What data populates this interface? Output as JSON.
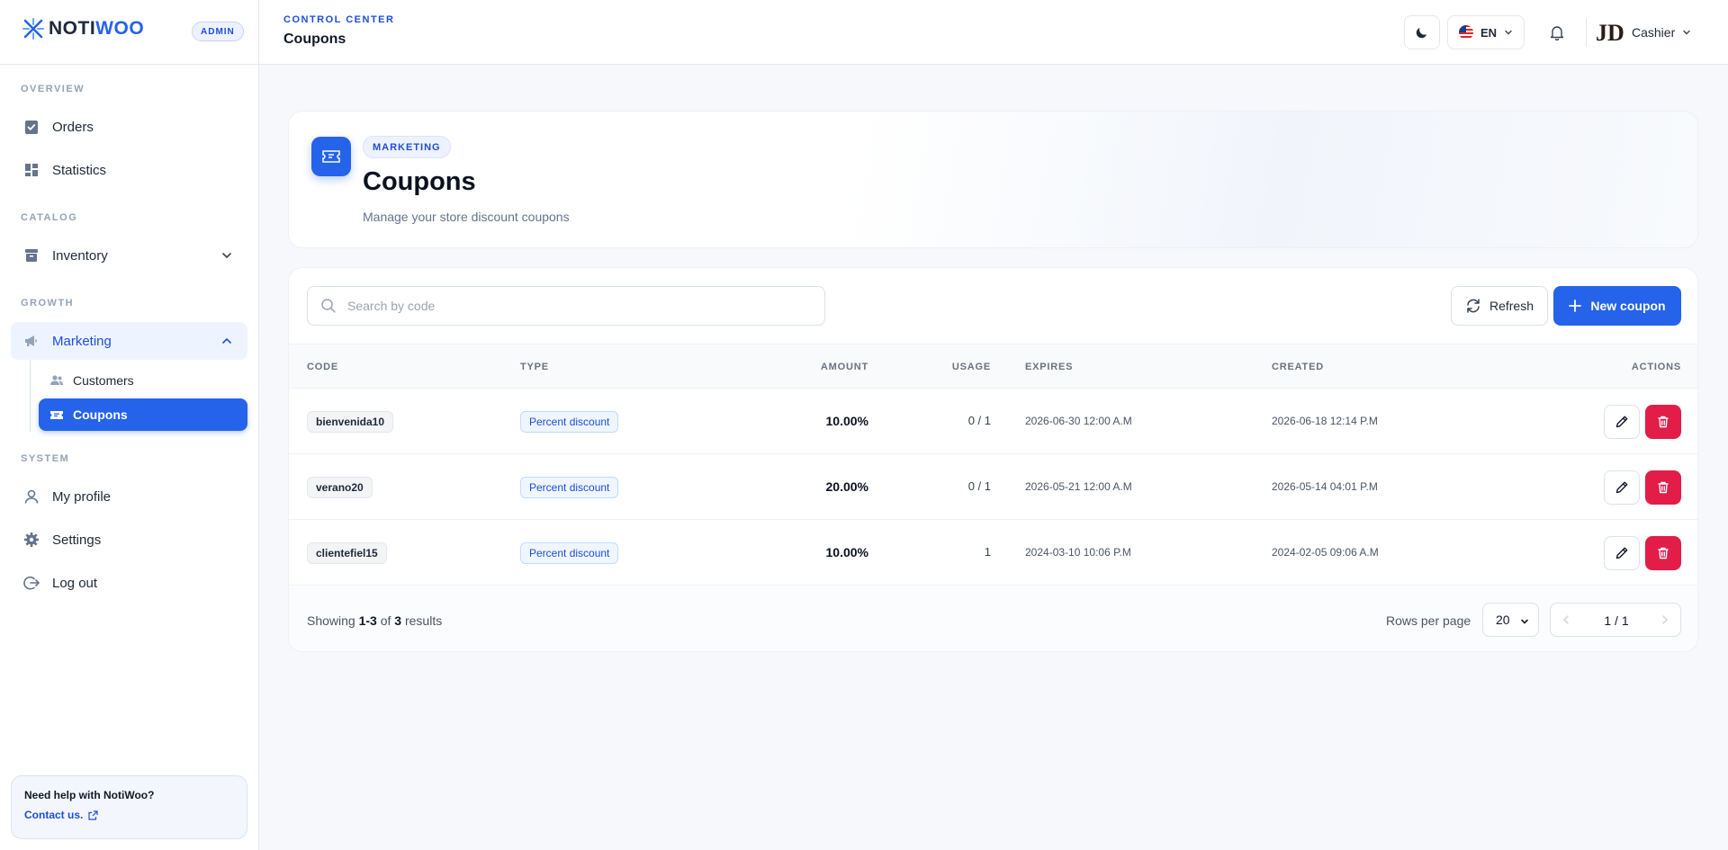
{
  "brand": {
    "name_part1": "NOTI",
    "name_part2": "WOO",
    "role_badge": "ADMIN"
  },
  "sidebar": {
    "sections": {
      "overview": "OVERVIEW",
      "catalog": "CATALOG",
      "growth": "GROWTH",
      "system": "SYSTEM"
    },
    "items": {
      "orders": "Orders",
      "statistics": "Statistics",
      "inventory": "Inventory",
      "marketing": "Marketing",
      "customers": "Customers",
      "coupons": "Coupons",
      "my_profile": "My profile",
      "settings": "Settings",
      "log_out": "Log out"
    },
    "help": {
      "title": "Need help with NotiWoo?",
      "link": "Contact us."
    }
  },
  "header": {
    "breadcrumb": "CONTROL CENTER",
    "title": "Coupons",
    "language": "EN",
    "avatar_initials": "JD",
    "user_name": "Cashier"
  },
  "hero": {
    "pill": "MARKETING",
    "title": "Coupons",
    "subtitle": "Manage your store discount coupons"
  },
  "toolbar": {
    "search_placeholder": "Search by code",
    "refresh_label": "Refresh",
    "new_label": "New coupon"
  },
  "table": {
    "columns": {
      "code": "CODE",
      "type": "TYPE",
      "amount": "AMOUNT",
      "usage": "USAGE",
      "expires": "EXPIRES",
      "created": "CREATED",
      "actions": "ACTIONS"
    },
    "rows": [
      {
        "code": "bienvenida10",
        "type": "Percent discount",
        "amount": "10.00%",
        "usage": "0 / 1",
        "expires": "2026-06-30 12:00 A.M",
        "created": "2026-06-18 12:14 P.M"
      },
      {
        "code": "verano20",
        "type": "Percent discount",
        "amount": "20.00%",
        "usage": "0 / 1",
        "expires": "2026-05-21 12:00 A.M",
        "created": "2026-05-14 04:01 P.M"
      },
      {
        "code": "clientefiel15",
        "type": "Percent discount",
        "amount": "10.00%",
        "usage": "1",
        "expires": "2024-03-10 10:06 P.M",
        "created": "2024-02-05 09:06 A.M"
      }
    ]
  },
  "pagination": {
    "showing_prefix": "Showing",
    "range": "1-3",
    "of_label": "of",
    "total": "3",
    "results_label": "results",
    "rows_per_page_label": "Rows per page",
    "rows_per_page_value": "20",
    "page_indicator": "1 / 1"
  },
  "colors": {
    "accent": "#2563eb",
    "danger": "#e11d48",
    "accent_text": "#1d4ed8"
  },
  "icons": {
    "orders": "clipboard-check-icon",
    "statistics": "dashboard-grid-icon",
    "inventory": "archive-icon",
    "marketing": "megaphone-icon",
    "customers": "users-icon",
    "coupons": "ticket-icon",
    "profile": "user-icon",
    "settings": "gear-icon",
    "logout": "logout-icon"
  }
}
